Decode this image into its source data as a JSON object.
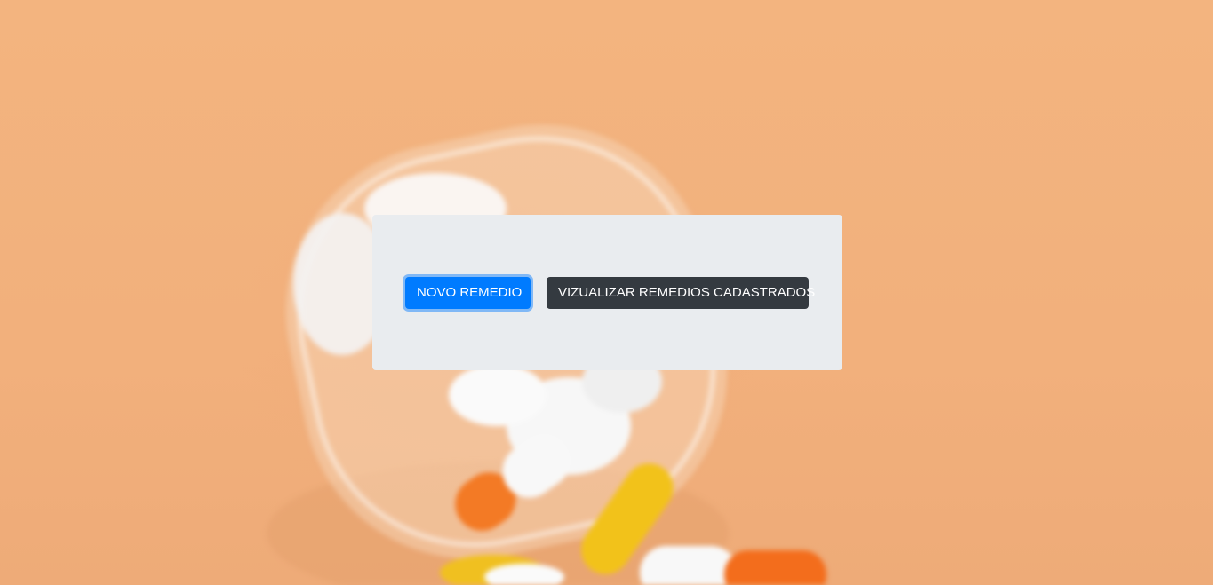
{
  "actions": {
    "new_label": "NOVO REMEDIO",
    "view_label": "VIZUALIZAR REMEDIOS CADASTRADOS"
  },
  "colors": {
    "primary": "#007bff",
    "dark": "#343a40",
    "card_bg": "#e9ecef",
    "page_bg": "#f3b47f"
  },
  "background": {
    "icon": "pill-bottle-photo"
  }
}
